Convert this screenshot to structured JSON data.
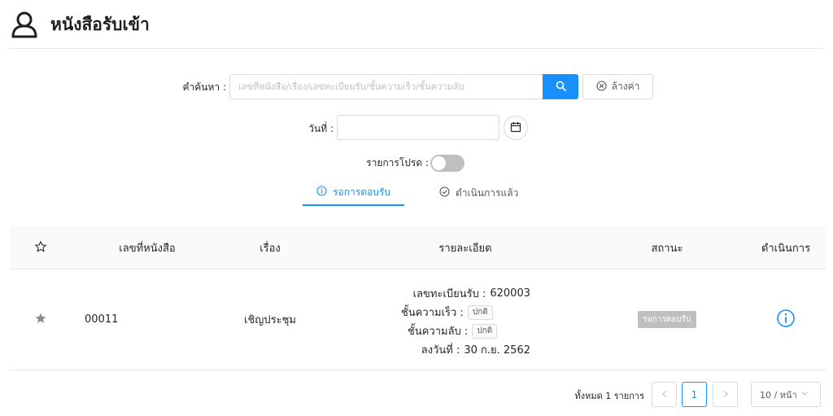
{
  "header": {
    "title": "หนังสือรับเข้า",
    "icon": "user-icon"
  },
  "search": {
    "label": "คำค้นหา :",
    "placeholder": "เลขที่หนังสือ/เรื่อง/เลขทะเบียนรับ/ชั้นความเร็ว/ชั้นความลับ",
    "value": "",
    "clear_label": "ล้างค่า"
  },
  "date_filter": {
    "label": "วันที่ :",
    "value": ""
  },
  "favorites": {
    "label": "รายการโปรด :",
    "enabled": false
  },
  "tabs": [
    {
      "label": "รอการตอบรับ",
      "icon": "info-circle-icon",
      "active": true
    },
    {
      "label": "ดำเนินการแล้ว",
      "icon": "check-circle-icon",
      "active": false
    }
  ],
  "table": {
    "columns": [
      "เลขที่หนังสือ",
      "เรื่อง",
      "รายละเอียด",
      "สถานะ",
      "ดำเนินการ"
    ],
    "rows": [
      {
        "doc_no": "00011",
        "subject": "เชิญประชุม",
        "reg_label": "เลขทะเบียนรับ :",
        "reg_no": "620003",
        "speed_label": "ชั้นความเร็ว :",
        "speed": "ปกติ",
        "secret_label": "ชั้นความลับ :",
        "secret": "ปกติ",
        "date_label": "ลงวันที่ :",
        "date": "30 ก.ย. 2562",
        "status": "รอการตอบรับ"
      }
    ]
  },
  "pagination": {
    "total": "ทั้งหมด 1 รายการ",
    "current_page": "1",
    "page_size": "10 / หน้า"
  },
  "colors": {
    "primary": "#1890ff",
    "muted": "#bfbfbf",
    "border": "#d9d9d9"
  }
}
